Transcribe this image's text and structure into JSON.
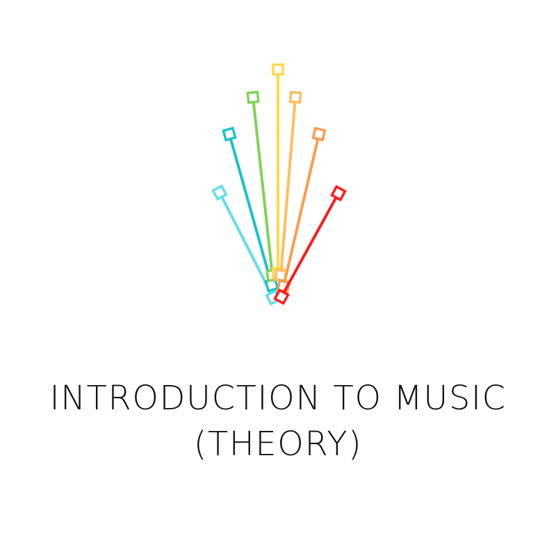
{
  "title": {
    "line1": "INTRODUCTION TO MUSIC",
    "line2": "(THEORY)"
  },
  "colors": {
    "background": "#ffffff",
    "text": "#111111",
    "stems": [
      "#5fdfe6",
      "#15c2cc",
      "#7fd356",
      "#ffd84d",
      "#ffbd5e",
      "#ff9a4d",
      "#ff1a1a"
    ]
  },
  "logo": {
    "icon": "color-fan-sticks-icon"
  }
}
